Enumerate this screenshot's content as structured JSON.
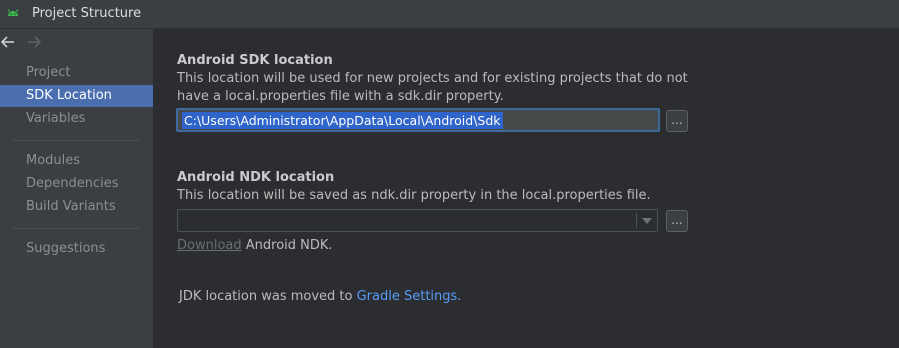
{
  "window": {
    "title": "Project Structure",
    "icon": "android-icon",
    "accent_color": "#3dba4e"
  },
  "sidebar": {
    "back_icon": "arrow-left-icon",
    "forward_icon": "arrow-right-icon",
    "groups": [
      {
        "items": [
          {
            "label": "Project",
            "selected": false
          },
          {
            "label": "SDK Location",
            "selected": true
          },
          {
            "label": "Variables",
            "selected": false
          }
        ]
      },
      {
        "items": [
          {
            "label": "Modules",
            "selected": false
          },
          {
            "label": "Dependencies",
            "selected": false
          },
          {
            "label": "Build Variants",
            "selected": false
          }
        ]
      },
      {
        "items": [
          {
            "label": "Suggestions",
            "selected": false
          }
        ]
      }
    ],
    "selection_color": "#4b6eaf"
  },
  "main": {
    "sdk": {
      "heading": "Android SDK location",
      "description": "This location will be used for new projects and for existing projects that do not have a local.properties file with a sdk.dir property.",
      "path_value": "C:\\Users\\Administrator\\AppData\\Local\\Android\\Sdk",
      "browse_label": "..."
    },
    "ndk": {
      "heading": "Android NDK location",
      "description": "This location will be saved as ndk.dir property in the local.properties file.",
      "path_value": "",
      "browse_label": "...",
      "download_link": "Download",
      "download_rest": " Android NDK."
    },
    "jdk": {
      "text": "JDK location was moved to ",
      "link": "Gradle Settings."
    },
    "link_color": "#589df6"
  }
}
